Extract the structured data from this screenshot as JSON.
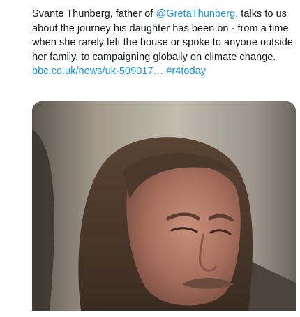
{
  "tweet": {
    "text_part1": "Svante Thunberg, father of ",
    "mention": "@GretaThunberg",
    "text_part2": ", talks to us about the journey his daughter has been on - from a time when she rarely left the house or spoke to anyone outside her family, to campaigning globally on climate change. ",
    "link": "bbc.co.uk/news/uk-509017…",
    "hashtag": "#r4today"
  },
  "media": {
    "type": "video-thumbnail"
  },
  "colors": {
    "text": "#14171a",
    "link": "#1b95e0",
    "background": "#ffffff"
  }
}
